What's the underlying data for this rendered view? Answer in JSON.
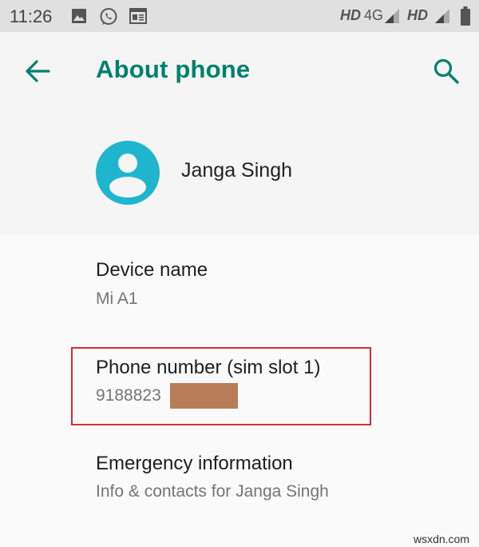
{
  "status_bar": {
    "time": "11:26",
    "left_icons": [
      "gallery-icon",
      "whatsapp-icon",
      "news-icon"
    ],
    "network_1_label": "HD",
    "network_1_type": "4G",
    "network_2_label": "HD",
    "battery_icon": "battery-icon"
  },
  "app_bar": {
    "title": "About phone",
    "back_icon": "arrow-back-icon",
    "search_icon": "search-icon",
    "accent_color": "#00806e"
  },
  "profile": {
    "name": "Janga Singh",
    "avatar_color": "#1fb5cf"
  },
  "settings": [
    {
      "title": "Device name",
      "summary": "Mi A1"
    },
    {
      "title": "Phone number (sim slot 1)",
      "summary": "9188823",
      "summary_redacted": true
    },
    {
      "title": "Emergency information",
      "summary": "Info & contacts for Janga Singh"
    }
  ],
  "annotation": {
    "highlight_color": "#d92b35"
  },
  "watermark": "wsxdn.com"
}
